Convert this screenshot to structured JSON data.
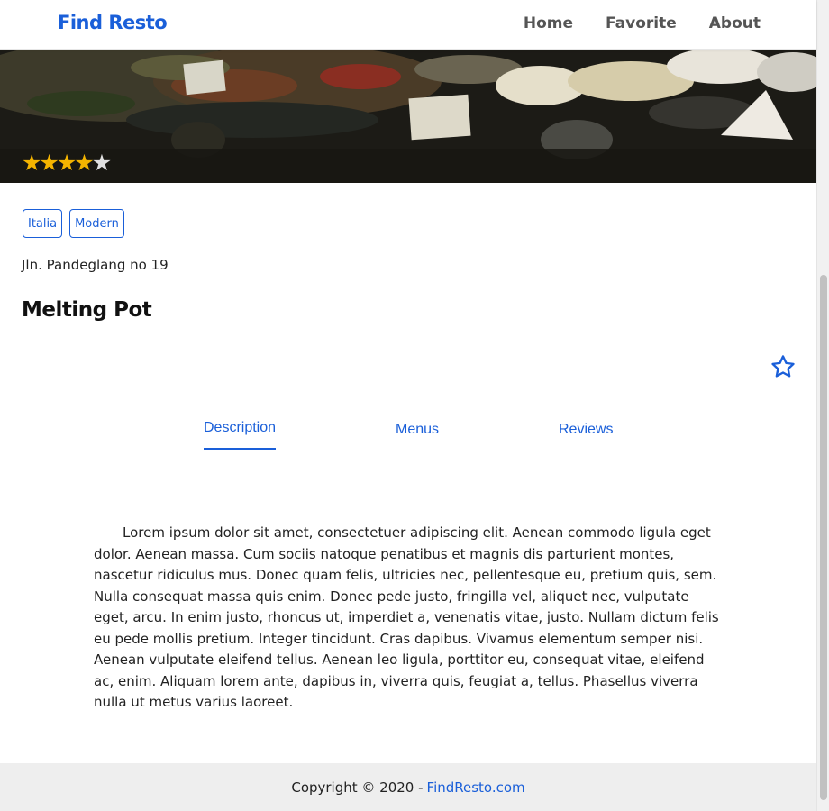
{
  "header": {
    "brand": "Find Resto",
    "nav": [
      "Home",
      "Favorite",
      "About"
    ]
  },
  "restaurant": {
    "rating": 4,
    "rating_max": 5,
    "categories": [
      "Italia",
      "Modern"
    ],
    "address": "Jln. Pandeglang no 19",
    "name": "Melting Pot",
    "favorite_icon": "star-outline-icon"
  },
  "tabs": {
    "active": "Description",
    "items": [
      "Description",
      "Menus",
      "Reviews"
    ]
  },
  "description": "Lorem ipsum dolor sit amet, consectetuer adipiscing elit. Aenean commodo ligula eget dolor. Aenean massa. Cum sociis natoque penatibus et magnis dis parturient montes, nascetur ridiculus mus. Donec quam felis, ultricies nec, pellentesque eu, pretium quis, sem. Nulla consequat massa quis enim. Donec pede justo, fringilla vel, aliquet nec, vulputate eget, arcu. In enim justo, rhoncus ut, imperdiet a, venenatis vitae, justo. Nullam dictum felis eu pede mollis pretium. Integer tincidunt. Cras dapibus. Vivamus elementum semper nisi. Aenean vulputate eleifend tellus. Aenean leo ligula, porttitor eu, consequat vitae, eleifend ac, enim. Aliquam lorem ante, dapibus in, viverra quis, feugiat a, tellus. Phasellus viverra nulla ut metus varius laoreet.",
  "footer": {
    "text": "Copyright © 2020 -",
    "link": "FindResto.com"
  },
  "colors": {
    "accent": "#1a5fd9",
    "star": "#f4b400",
    "footer_bg": "#eeeeee"
  }
}
